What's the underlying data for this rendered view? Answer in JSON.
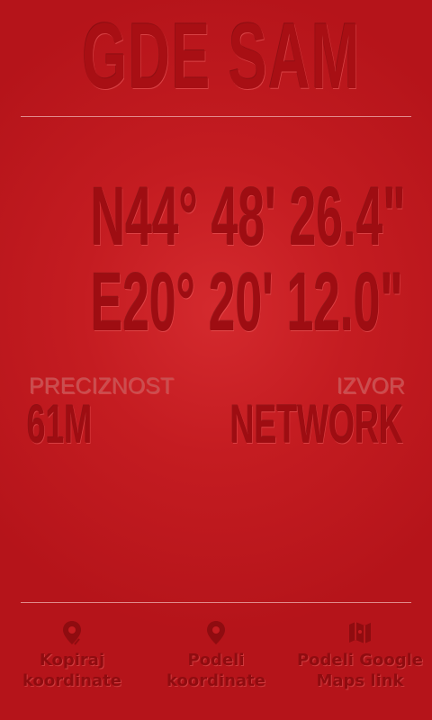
{
  "app": {
    "title": "GDE SAM"
  },
  "location": {
    "latitude": "N44° 48' 26.4\"",
    "longitude": "E20° 20' 12.0\""
  },
  "stats": {
    "accuracy_label": "PRECIZNOST",
    "accuracy_value": "61M",
    "source_label": "IZVOR",
    "source_value": "NETWORK"
  },
  "actions": [
    {
      "icon": "map-pin-icon",
      "label_line1": "Kopiraj",
      "label_line2": "koordinate"
    },
    {
      "icon": "map-pin-icon",
      "label_line1": "Podeli",
      "label_line2": "koordinate"
    },
    {
      "icon": "folded-map-icon",
      "label_line1": "Podeli Google",
      "label_line2": "Maps link"
    }
  ],
  "colors": {
    "background": "#c41c21",
    "text_dark_red": "#9e0d12",
    "label_faded": "#c84f50",
    "divider": "#e8a0a0"
  }
}
